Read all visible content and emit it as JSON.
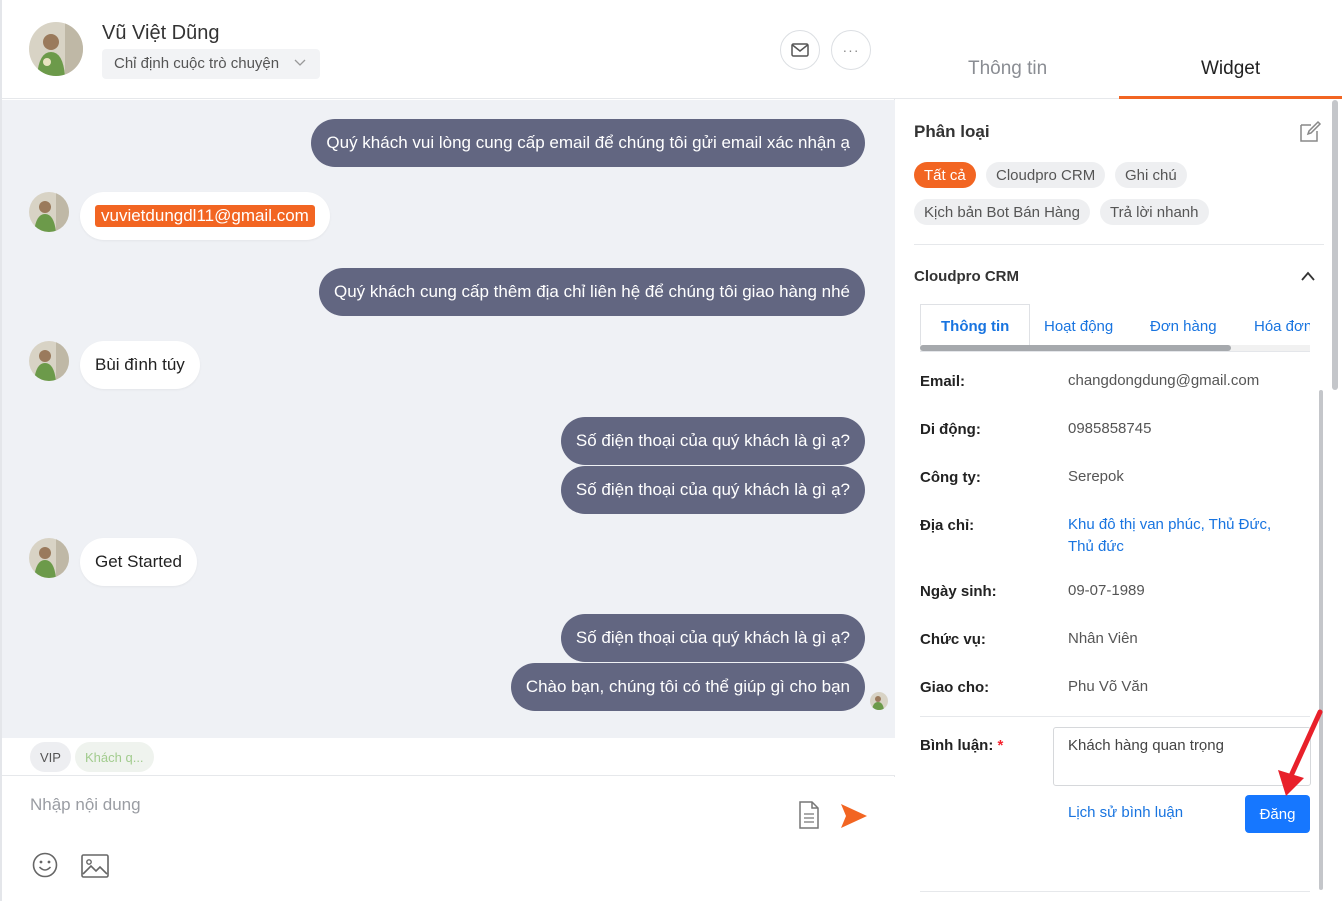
{
  "header": {
    "contact_name": "Vũ Việt Dũng",
    "assign_placeholder": "Chỉ định cuộc trò chuyện",
    "mail_icon": "mail-icon",
    "more_icon": "more-icon",
    "more_label": "···"
  },
  "messages": [
    {
      "direction": "out",
      "text": "Quý khách vui lòng cung cấp email để chúng tôi gửi email xác nhận ạ"
    },
    {
      "direction": "in",
      "text": "vuvietdungdl11@gmail.com",
      "highlight": true
    },
    {
      "direction": "out",
      "text": "Quý khách cung cấp thêm địa chỉ liên hệ để chúng tôi giao hàng nhé"
    },
    {
      "direction": "in",
      "text": "Bùi đình túy"
    },
    {
      "direction": "out",
      "text": "Số điện thoại của quý khách là gì ạ?"
    },
    {
      "direction": "out",
      "text": "Số điện thoại của quý khách là gì ạ?"
    },
    {
      "direction": "in",
      "text": "Get Started"
    },
    {
      "direction": "out",
      "text": "Số điện thoại của quý khách là gì ạ?"
    },
    {
      "direction": "out",
      "text": "Chào bạn, chúng tôi có thể giúp gì cho bạn"
    }
  ],
  "conversation_tags": [
    "VIP",
    "Khách q..."
  ],
  "composer": {
    "placeholder": "Nhập nội dung",
    "icons": [
      "document-icon",
      "send-icon",
      "emoji-icon",
      "image-icon"
    ]
  },
  "panel": {
    "tabs": [
      {
        "label": "Thông tin",
        "active": false
      },
      {
        "label": "Widget",
        "active": true
      }
    ],
    "classification_title": "Phân loại",
    "classification_chips": [
      {
        "label": "Tất cả",
        "active": true
      },
      {
        "label": "Cloudpro CRM",
        "active": false
      },
      {
        "label": "Ghi chú",
        "active": false
      },
      {
        "label": "Kịch bản Bot Bán Hàng",
        "active": false
      },
      {
        "label": "Trả lời nhanh",
        "active": false
      }
    ],
    "crm_title": "Cloudpro CRM",
    "crm_tabs": [
      {
        "label": "Thông tin",
        "active": true
      },
      {
        "label": "Hoạt động",
        "active": false
      },
      {
        "label": "Đơn hàng",
        "active": false
      },
      {
        "label": "Hóa đơn",
        "active": false
      }
    ],
    "fields": [
      {
        "label": "Email:",
        "value": "changdongdung@gmail.com"
      },
      {
        "label": "Di động:",
        "value": "0985858745"
      },
      {
        "label": "Công ty:",
        "value": "Serepok"
      },
      {
        "label": "Địa chỉ:",
        "value": "Khu đô thị van phúc, Thủ Đức, Thủ đức",
        "link": true
      },
      {
        "label": "Ngày sinh:",
        "value": "09-07-1989"
      },
      {
        "label": "Chức vụ:",
        "value": "Nhân Viên"
      },
      {
        "label": "Giao cho:",
        "value": "Phu Võ Văn"
      }
    ],
    "comment": {
      "label": "Bình luận:",
      "required_mark": "*",
      "value": "Khách hàng quan trọng",
      "history_link": "Lịch sử bình luận",
      "post_button": "Đăng"
    }
  },
  "colors": {
    "accent": "#f26522",
    "bubble_out": "#626681",
    "chat_bg": "#eff1f5",
    "link": "#1874e0",
    "primary_button": "#1677ff"
  }
}
